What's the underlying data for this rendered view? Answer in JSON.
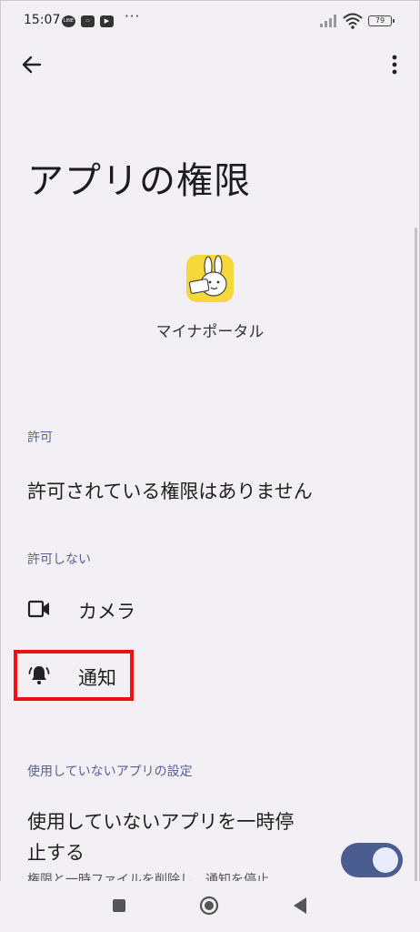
{
  "status_bar": {
    "time": "15:07",
    "icons": [
      "line-icon",
      "chat-icon",
      "youtube-icon"
    ],
    "more_dots": "···",
    "battery": "79"
  },
  "header": {
    "back_icon": "arrow-back-icon",
    "more_icon": "more-vertical-icon",
    "title": "アプリの権限"
  },
  "app": {
    "name": "マイナポータル",
    "icon": "mynaportal-app-icon"
  },
  "allowed": {
    "heading": "許可",
    "empty_text": "許可されている権限はありません"
  },
  "not_allowed": {
    "heading": "許可しない",
    "items": [
      {
        "icon": "camera-icon",
        "label": "カメラ"
      },
      {
        "icon": "bell-icon",
        "label": "通知"
      }
    ]
  },
  "unused": {
    "heading": "使用していないアプリの設定",
    "pause_label_line1": "使用していないアプリを一時停",
    "pause_label_line2": "止する",
    "pause_description": "権限と一時ファイルを削除し、通知を停止",
    "pause_enabled": true
  },
  "colors": {
    "background": "#f2f0f5",
    "accent": "#4b5c91",
    "section_heading": "#5a5f9a",
    "highlight": "#ee1111"
  }
}
